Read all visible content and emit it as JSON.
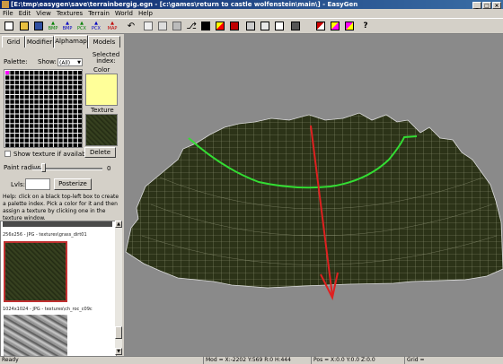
{
  "window": {
    "title": "[E:\\tmp\\easygen\\save\\terrainbergig.egn - [c:\\games\\return to castle wolfenstein\\main\\] - EasyGen",
    "min": "_",
    "max": "□",
    "close": "×"
  },
  "menu": [
    "File",
    "Edit",
    "View",
    "Textures",
    "Terrain",
    "World",
    "Help"
  ],
  "toolbar": {
    "bmp1": "BMP",
    "bmp2": "BMP",
    "pcx1": "PCX",
    "pcx2": "PCX",
    "map": "MAP",
    "help": "?"
  },
  "tabs": [
    "Grid",
    "Modifier",
    "Alphamap",
    "Models"
  ],
  "active_tab": "Alphamap",
  "palette": {
    "label": "Palette:",
    "show_label": "Show:",
    "show_value": "(All)",
    "selected_index": "Selected index:",
    "color_label": "Color",
    "texture_label": "Texture",
    "color": "#ffff99"
  },
  "show_texture_checkbox": "Show texture if available",
  "delete_button": "Delete",
  "paint_radius": {
    "label": "Paint radius:",
    "value": "0"
  },
  "lvls": {
    "label": "Lvls:",
    "posterize_button": "Posterize"
  },
  "help_text": "Help: click on a black top-left box to create a palette index. Pick a color for it and then assign a texture by clicking one in the texture window.",
  "textures": [
    {
      "label": "256x256 - JPG - textures\\grass_dirt01"
    },
    {
      "label": "1024x1024 - JPG - textures\\ch_roc_c09c"
    }
  ],
  "status": {
    "ready": "Ready",
    "mod": "Mod = X:-2202 Y:569 R:0 H:444",
    "pos": "Pos = X:0.0 Y:0.0 Z:0.0",
    "grid": "Grid = "
  }
}
